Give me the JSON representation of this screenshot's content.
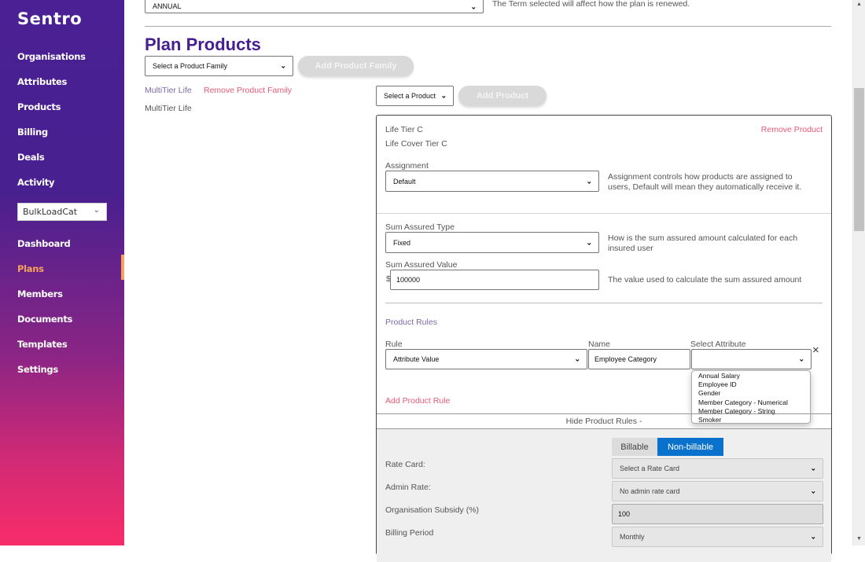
{
  "sidebar": {
    "logo": "Sentro",
    "nav_top": [
      {
        "label": "Organisations"
      },
      {
        "label": "Attributes"
      },
      {
        "label": "Products"
      },
      {
        "label": "Billing"
      },
      {
        "label": "Deals"
      },
      {
        "label": "Activity"
      }
    ],
    "org_select": "BulkLoadCat",
    "nav_bottom": [
      {
        "label": "Dashboard",
        "active": false
      },
      {
        "label": "Plans",
        "active": true
      },
      {
        "label": "Members",
        "active": false
      },
      {
        "label": "Documents",
        "active": false
      },
      {
        "label": "Templates",
        "active": false
      },
      {
        "label": "Settings",
        "active": false
      }
    ],
    "active_color": "#f6a25c"
  },
  "term": {
    "value": "ANNUAL",
    "help": "The Term selected will affect how the plan is renewed."
  },
  "plan_products": {
    "title": "Plan Products",
    "family_select_placeholder": "Select a Product Family",
    "add_family_button": "Add Product Family",
    "family_name": "MultiTier Life",
    "remove_family_link": "Remove Product Family",
    "family_item": "MultiTier Life",
    "product_select_placeholder": "Select a Product",
    "add_product_button": "Add Product"
  },
  "product": {
    "name": "Life Tier C",
    "description": "Life Cover Tier C",
    "remove_link": "Remove Product",
    "assignment": {
      "label": "Assignment",
      "value": "Default",
      "help_line1": "Assignment controls how products are assigned to",
      "help_line2": "users, Default will mean they automatically receive it."
    },
    "sum_assured_type": {
      "label": "Sum Assured Type",
      "value": "Fixed",
      "help_line1": "How is the sum assured amount calculated for each",
      "help_line2": "insured user"
    },
    "sum_assured_value": {
      "label": "Sum Assured Value",
      "currency": "$",
      "value": "100000",
      "help": "The value used to calculate the sum assured amount"
    },
    "product_rules": {
      "title": "Product Rules",
      "rule_label": "Rule",
      "name_label": "Name",
      "attribute_label": "Select Attribute",
      "rule_value": "Attribute Value",
      "name_value": "Employee Category",
      "attribute_value": "",
      "attribute_options": [
        "Annual Salary",
        "Employee ID",
        "Gender",
        "Member Category - Numerical",
        "Member Category - String",
        "Smoker"
      ],
      "remove_icon": "×",
      "add_rule_link": "Add Product Rule",
      "hide_rules_link": "Hide Product Rules -"
    },
    "billing": {
      "toggle_options": [
        "Billable",
        "Non-billable"
      ],
      "toggle_selected": "Non-billable",
      "toggle_color": "#0a72cc",
      "rate_card_label": "Rate Card:",
      "rate_card_value": "Select a Rate Card",
      "admin_rate_label": "Admin Rate:",
      "admin_rate_value": "No admin rate card",
      "subsidy_label": "Organisation Subsidy (%)",
      "subsidy_value": "100",
      "billing_period_label": "Billing Period",
      "billing_period_value": "Monthly"
    }
  },
  "scrollbar": {
    "up_arrow": "▲",
    "down_arrow": "▼"
  }
}
